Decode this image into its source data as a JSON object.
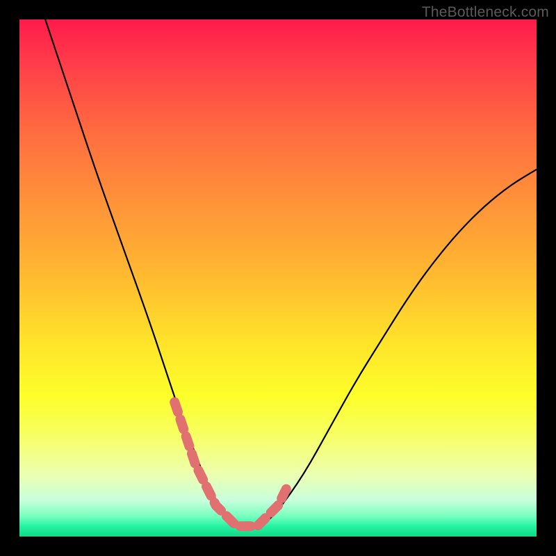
{
  "attribution": "TheBottleneck.com",
  "chart_data": {
    "type": "line",
    "title": "",
    "xlabel": "",
    "ylabel": "",
    "xlim": [
      0,
      100
    ],
    "ylim": [
      0,
      100
    ],
    "series": [
      {
        "name": "bottleneck-curve",
        "x": [
          5,
          10,
          15,
          20,
          25,
          28,
          31,
          34,
          36,
          38,
          40,
          42,
          44,
          46,
          48,
          50,
          55,
          60,
          65,
          70,
          75,
          80,
          85,
          90,
          95,
          100
        ],
        "y": [
          100,
          85,
          70,
          56,
          42,
          33,
          24,
          16,
          11,
          7,
          4,
          2,
          2,
          2,
          3,
          5,
          12,
          21,
          30,
          38,
          46,
          53,
          59,
          64,
          68,
          71
        ]
      },
      {
        "name": "highlight-band",
        "x": [
          30,
          32,
          34,
          36,
          38,
          40,
          42,
          44,
          46,
          48,
          50,
          52
        ],
        "y": [
          26,
          20,
          14,
          10,
          6,
          4,
          2,
          2,
          2,
          4,
          6,
          10
        ]
      }
    ],
    "gradient_stops": [
      {
        "pct": 0,
        "color": "#ff1a4b"
      },
      {
        "pct": 22,
        "color": "#ff6d3f"
      },
      {
        "pct": 48,
        "color": "#ffb531"
      },
      {
        "pct": 73,
        "color": "#fdff2a"
      },
      {
        "pct": 93,
        "color": "#c8ffdc"
      },
      {
        "pct": 100,
        "color": "#0ed987"
      }
    ]
  }
}
